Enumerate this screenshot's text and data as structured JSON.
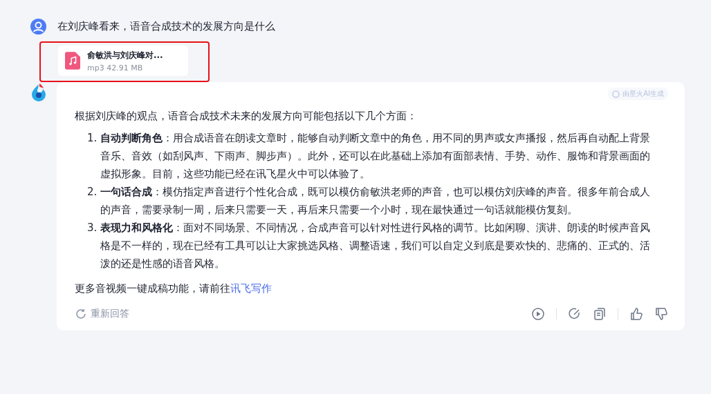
{
  "question": {
    "text": "在刘庆峰看来，语音合成技术的发展方向是什么"
  },
  "attachment": {
    "name": "俞敏洪与刘庆峰对...",
    "meta": "mp3 42.91 MB"
  },
  "answer": {
    "badge": "由星火AI生成",
    "intro": "根据刘庆峰的观点，语音合成技术未来的发展方向可能包括以下几个方面：",
    "items": [
      {
        "number": "1.",
        "title": "自动判断角色",
        "text": "：用合成语音在朗读文章时，能够自动判断文章中的角色，用不同的男声或女声播报，然后再自动配上背景音乐、音效（如刮风声、下雨声、脚步声）。此外，还可以在此基础上添加有面部表情、手势、动作、服饰和背景画面的虚拟形象。目前，这些功能已经在讯飞星火中可以体验了。"
      },
      {
        "number": "2.",
        "title": "一句话合成",
        "text": "：模仿指定声音进行个性化合成，既可以模仿俞敏洪老师的声音，也可以模仿刘庆峰的声音。很多年前合成人的声音，需要录制一周，后来只需要一天，再后来只需要一个小时，现在最快通过一句话就能模仿复刻。"
      },
      {
        "number": "3.",
        "title": "表现力和风格化",
        "text": "：面对不同场景、不同情况，合成声音可以针对性进行风格的调节。比如闲聊、演讲、朗读的时候声音风格是不一样的，现在已经有工具可以让大家挑选风格、调整语速，我们可以自定义到底是要欢快的、悲痛的、正式的、活泼的还是性感的语音风格。"
      }
    ],
    "footer_text": "更多音视频一键成稿功能，请前往",
    "footer_link": "讯飞写作",
    "regenerate": "重新回答"
  }
}
